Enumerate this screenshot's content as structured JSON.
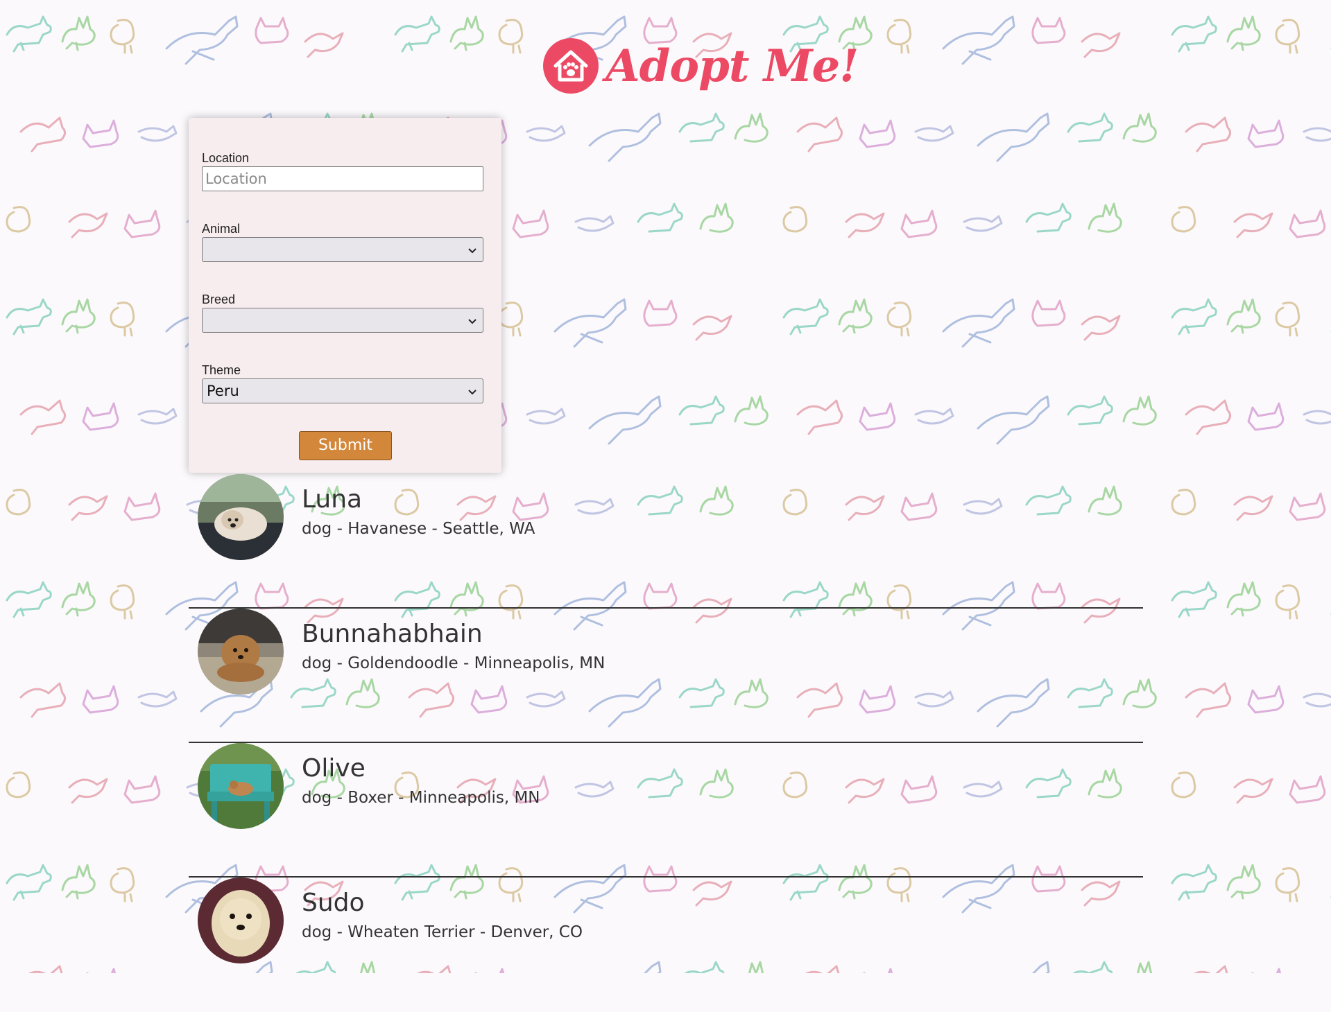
{
  "app": {
    "title": "Adopt Me!",
    "brand_color": "#ec4a64"
  },
  "header": {
    "logo_icon": "house-paw-icon",
    "logo_text": "Adopt Me!"
  },
  "search_form": {
    "location": {
      "label": "Location",
      "placeholder": "Location",
      "value": ""
    },
    "animal": {
      "label": "Animal",
      "value": "",
      "icon": "chevron-down-icon"
    },
    "breed": {
      "label": "Breed",
      "value": "",
      "icon": "chevron-down-icon"
    },
    "theme": {
      "label": "Theme",
      "value": "Peru",
      "icon": "chevron-down-icon"
    },
    "submit_label": "Submit",
    "submit_color": "#d2873b"
  },
  "pets": [
    {
      "name": "Luna",
      "description": "dog - Havanese - Seattle, WA"
    },
    {
      "name": "Bunnahabhain",
      "description": "dog - Goldendoodle - Minneapolis, MN"
    },
    {
      "name": "Olive",
      "description": "dog - Boxer - Minneapolis, MN"
    },
    {
      "name": "Sudo",
      "description": "dog - Wheaten Terrier - Denver, CO"
    }
  ]
}
